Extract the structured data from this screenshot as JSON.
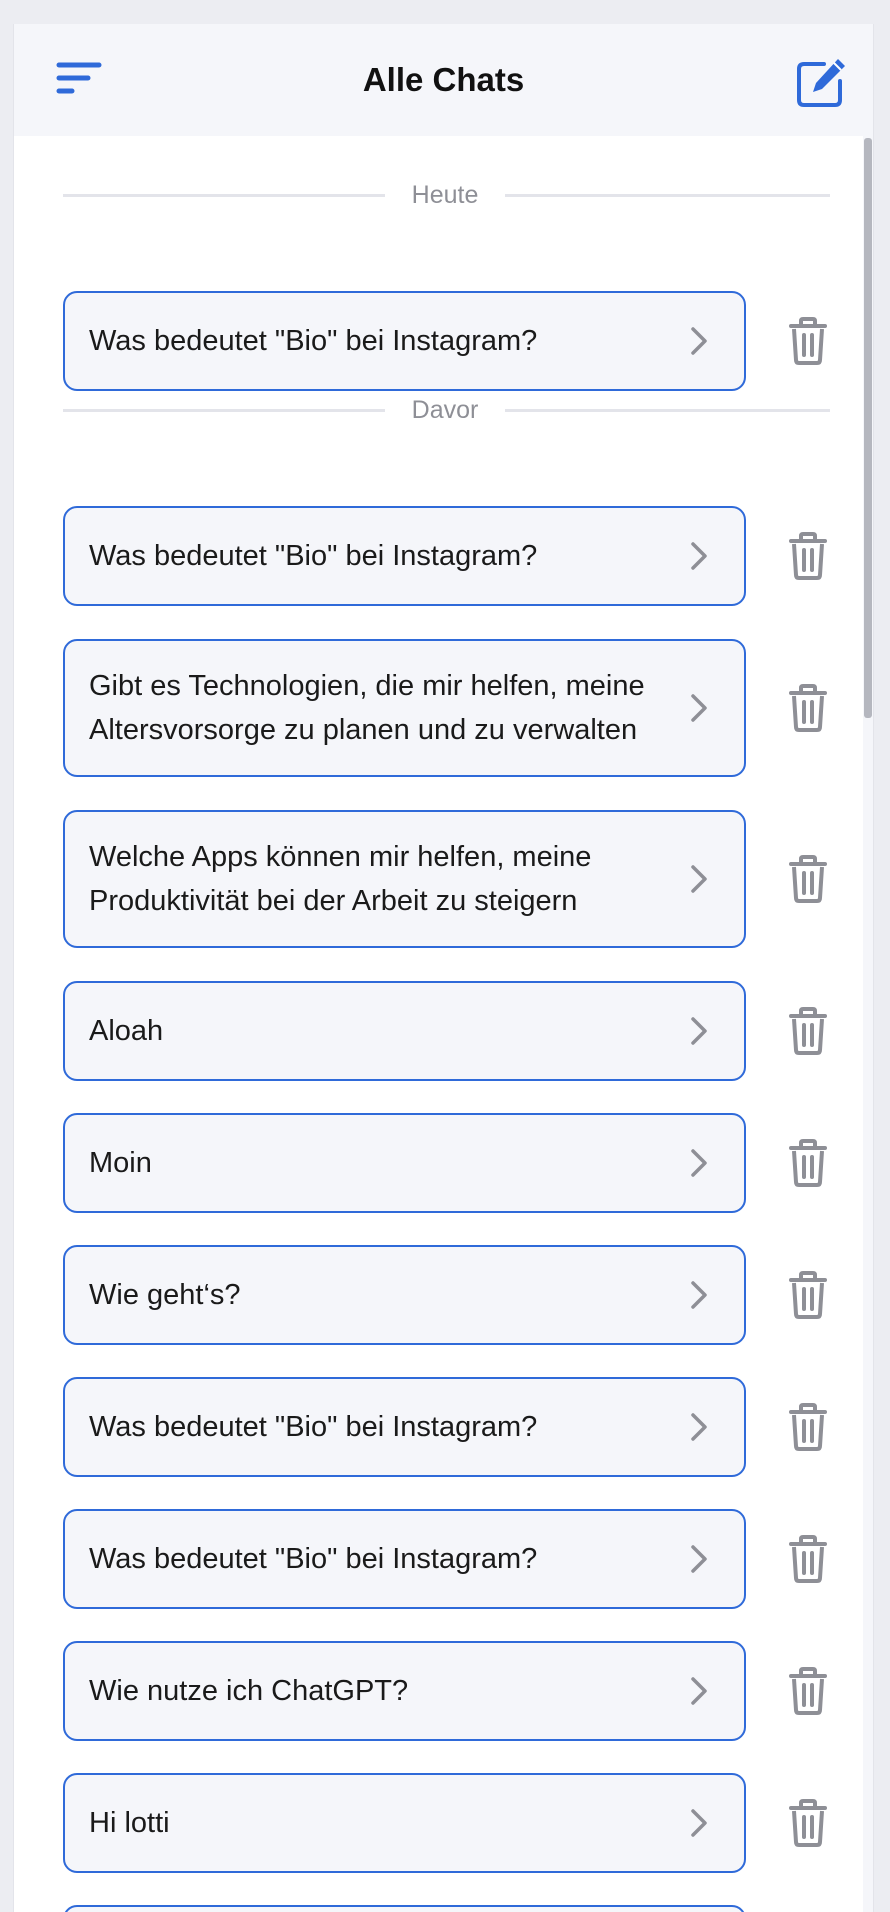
{
  "header": {
    "title": "Alle Chats",
    "menu_icon": "menu-icon",
    "compose_icon": "compose-icon"
  },
  "colors": {
    "accent": "#2f6ad9",
    "card_bg": "#f5f6fa",
    "divider": "#e3e4ea",
    "icon_gray": "#8e8f96"
  },
  "sections": [
    {
      "label": "Heute"
    },
    {
      "label": "Davor"
    }
  ],
  "chats": [
    {
      "title": "Was bedeutet \"Bio\" bei Instagram?",
      "section": "Heute"
    },
    {
      "title": "Was bedeutet \"Bio\" bei Instagram?",
      "section": "Davor"
    },
    {
      "title": "Gibt es Technologien, die mir helfen, meine Altersvorsorge zu planen und zu verwalten",
      "section": "Davor"
    },
    {
      "title": "Welche Apps können mir helfen, meine Produktivität bei der Arbeit zu steigern",
      "section": "Davor"
    },
    {
      "title": "Aloah",
      "section": "Davor"
    },
    {
      "title": "Moin",
      "section": "Davor"
    },
    {
      "title": "Wie geht‘s?",
      "section": "Davor"
    },
    {
      "title": "Was bedeutet \"Bio\" bei Instagram?",
      "section": "Davor"
    },
    {
      "title": "Was bedeutet \"Bio\" bei Instagram?",
      "section": "Davor"
    },
    {
      "title": "Wie nutze ich ChatGPT?",
      "section": "Davor"
    },
    {
      "title": "Hi lotti",
      "section": "Davor"
    },
    {
      "title": "",
      "section": "Davor"
    }
  ],
  "icons": {
    "chevron": "chevron-right-icon",
    "delete": "trash-icon"
  }
}
